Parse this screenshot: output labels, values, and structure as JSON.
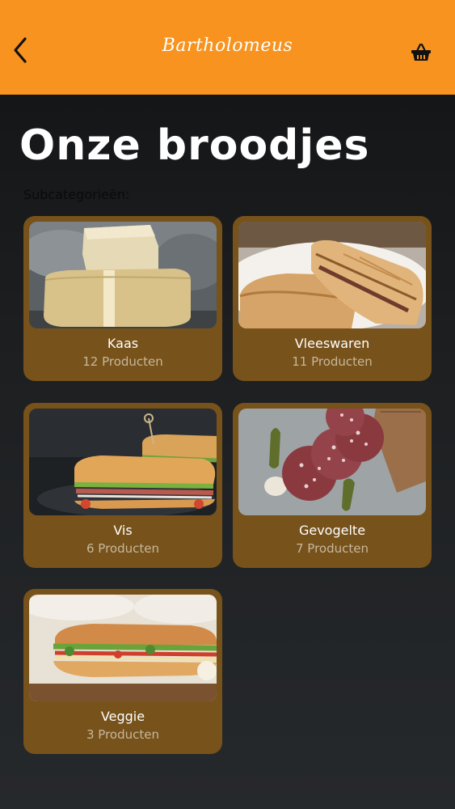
{
  "header": {
    "logo_text": "Bartholomeus",
    "back_icon": "chevron-left-icon",
    "basket_icon": "basket-icon",
    "background_color": "#f7931e"
  },
  "page": {
    "title": "Onze broodjes",
    "subcategories_label": "Subcategorieën:"
  },
  "categories": [
    {
      "name": "Kaas",
      "count": "12 Producten",
      "image": "cheese-photo"
    },
    {
      "name": "Vleeswaren",
      "count": "11 Producten",
      "image": "panini-photo"
    },
    {
      "name": "Vis",
      "count": "6 Producten",
      "image": "sub-sandwich-photo"
    },
    {
      "name": "Gevogelte",
      "count": "7 Producten",
      "image": "salami-photo"
    },
    {
      "name": "Veggie",
      "count": "3 Producten",
      "image": "veggie-sandwich-photo"
    }
  ],
  "colors": {
    "card_background": "#77521a",
    "accent": "#f7931e"
  }
}
